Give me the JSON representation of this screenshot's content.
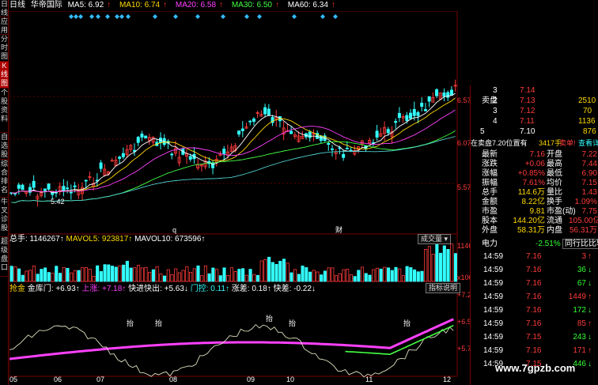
{
  "sidebar": {
    "tabs": [
      {
        "label": "日线"
      },
      {
        "label": "应用"
      },
      {
        "label": "分时图"
      },
      {
        "label": "K线图"
      },
      {
        "label": "个股资料"
      },
      {
        "label": "自选股"
      },
      {
        "label": "综合排名"
      },
      {
        "label": "牛叉诊股"
      },
      {
        "label": "超级盘口"
      }
    ]
  },
  "header": {
    "period": "日线",
    "stock_name": "华帝国际",
    "ma5": "MA5: 6.92",
    "ma10": "MA10: 6.74",
    "ma20": "MA20: 6.58",
    "ma30": "MA30: 6.50",
    "ma60": "MA60: 6.34",
    "up_arrow": "↑"
  },
  "main_chart": {
    "price_ticks": [
      "6.57",
      "6.07",
      "5.57"
    ],
    "low_label": "5.42",
    "markers": [
      "q",
      "财"
    ]
  },
  "volume_panel": {
    "total": "总手: 1146267↑",
    "mavol5": "MAVOL5: 923817↑",
    "mavol10": "MAVOL10: 673596↑",
    "dropdown": "成交量",
    "ticks": [
      "11463",
      "x100"
    ]
  },
  "indicator_panel": {
    "name": "抢金",
    "line1": "金库门: +6.93↑",
    "line2": "上涨: +7.18↑",
    "line3": "快进快出: +5.63↓",
    "line4": "门控: 0.11↑",
    "line5": "涨差: 0.18↑",
    "line6": "快差: -0.22↓",
    "help_button": "指标说明",
    "ticks": [
      "+7.21",
      "+6.50",
      "+5.77"
    ],
    "annotations": [
      "抬",
      "抬",
      "抬",
      "抬",
      "抬"
    ]
  },
  "x_axis": {
    "labels": [
      "05",
      "06",
      "07",
      "08",
      "09",
      "10",
      "11",
      "12"
    ]
  },
  "order_book": {
    "sell_label": "卖盘",
    "rows": [
      {
        "level": "3",
        "price": "7.14",
        "vol": ""
      },
      {
        "level": "2",
        "price": "7.13",
        "vol": "2510"
      },
      {
        "level": "3",
        "price": "7.12",
        "vol": "70"
      },
      {
        "level": "4",
        "price": "7.11",
        "vol": "1136"
      },
      {
        "level": "5",
        "price": "7.10",
        "vol": "876"
      }
    ]
  },
  "position": {
    "text": "在卖盘7.20位置有",
    "qty": "3417手",
    "action": "卖单!",
    "detail": "查看详细"
  },
  "stats": [
    {
      "k1": "最新",
      "v1": "7.16",
      "k2": "开盘",
      "v2": "7.22"
    },
    {
      "k1": "涨跌",
      "v1": "+0.06",
      "k2": "最高",
      "v2": "7.44"
    },
    {
      "k1": "涨幅",
      "v1": "+0.85%",
      "k2": "最低",
      "v2": "6.90"
    },
    {
      "k1": "振幅",
      "v1": "7.61%",
      "k2": "均价",
      "v2": "7.15"
    },
    {
      "k1": "总手",
      "v1": "114.6万",
      "k2": "量比",
      "v2": "1.43"
    },
    {
      "k1": "金额",
      "v1": "8.22亿",
      "k2": "换手",
      "v2": "1.09%"
    },
    {
      "k1": "市盈",
      "v1": "9.81",
      "k2": "市盈(动)",
      "v2": "7.75"
    },
    {
      "k1": "股本",
      "v1": "144.20亿",
      "k2": "流通",
      "v2": "105.00亿"
    },
    {
      "k1": "外盘",
      "v1": "58.31万",
      "k2": "内盘",
      "v2": "56.31万"
    }
  ],
  "power": {
    "label": "电力",
    "value": "-2.51%",
    "compare": "同行比比较"
  },
  "ticks_list": [
    {
      "time": "14:59",
      "price": "7.16",
      "vol": "3"
    },
    {
      "time": "14:59",
      "price": "7.16",
      "vol": "36"
    },
    {
      "time": "14:59",
      "price": "7.16",
      "vol": "67"
    },
    {
      "time": "14:59",
      "price": "7.16",
      "vol": "1449"
    },
    {
      "time": "14:59",
      "price": "7.16",
      "vol": "172"
    },
    {
      "time": "14:59",
      "price": "7.16",
      "vol": "85"
    },
    {
      "time": "14:59",
      "price": "7.15",
      "vol": "243"
    },
    {
      "time": "14:59",
      "price": "7.16",
      "vol": "171"
    },
    {
      "time": "14:59",
      "price": "7.15",
      "vol": "446"
    }
  ],
  "watermark": "www.7gpzb.com",
  "colors": {
    "up": "#ff3b3b",
    "down": "#33ffff",
    "ma5": "#ffffff",
    "ma10": "#ffd900",
    "ma20": "#ff40ff",
    "ma30": "#44ff44",
    "grid": "#7a0000"
  }
}
